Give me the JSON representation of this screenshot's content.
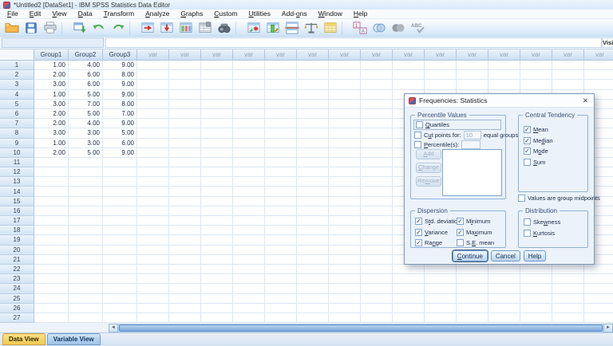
{
  "window": {
    "title": "*Untitled2 [DataSet1] - IBM SPSS Statistics Data Editor"
  },
  "menu": {
    "items": [
      {
        "label": "File",
        "mn": 0
      },
      {
        "label": "Edit",
        "mn": 0
      },
      {
        "label": "View",
        "mn": 0
      },
      {
        "label": "Data",
        "mn": 0
      },
      {
        "label": "Transform",
        "mn": 0
      },
      {
        "label": "Analyze",
        "mn": 0
      },
      {
        "label": "Graphs",
        "mn": 0
      },
      {
        "label": "Custom",
        "mn": 0
      },
      {
        "label": "Utilities",
        "mn": 0
      },
      {
        "label": "Add-ons",
        "mn": 4
      },
      {
        "label": "Window",
        "mn": 0
      },
      {
        "label": "Help",
        "mn": 0
      }
    ]
  },
  "toolbar": {
    "icons": [
      "open-data",
      "save",
      "print",
      "recall-dialogs",
      "undo",
      "redo",
      "goto-case",
      "goto-variable",
      "variables",
      "variable-properties",
      "find",
      "insert-cases",
      "insert-variable",
      "split-file",
      "weight-cases",
      "select-cases",
      "value-labels",
      "variable-sets",
      "show-all-variables",
      "spell-check"
    ]
  },
  "cellbar": {
    "visible_indicator": "Visi"
  },
  "grid": {
    "columns": [
      "Group1",
      "Group2",
      "Group3"
    ],
    "var_label": "var",
    "var_count": 15,
    "total_rows": 28,
    "rows": [
      [
        "1.00",
        "4.00",
        "9.00"
      ],
      [
        "2.00",
        "6.00",
        "8.00"
      ],
      [
        "3.00",
        "6.00",
        "9.00"
      ],
      [
        "1.00",
        "5.00",
        "9.00"
      ],
      [
        "3.00",
        "7.00",
        "8.00"
      ],
      [
        "2.00",
        "5.00",
        "7.00"
      ],
      [
        "2.00",
        "4.00",
        "9.00"
      ],
      [
        "3.00",
        "3.00",
        "5.00"
      ],
      [
        "1.00",
        "3.00",
        "6.00"
      ],
      [
        "2.00",
        "5.00",
        "9.00"
      ]
    ]
  },
  "tabs": {
    "data_view": "Data View",
    "variable_view": "Variable View"
  },
  "scrollbar": {
    "left_glyph": "◄",
    "right_glyph": "►"
  },
  "dialog": {
    "title": "Frequencies: Statistics",
    "close_glyph": "✕",
    "percentile_values": {
      "title": "Percentile Values",
      "quartiles": {
        "label": "Quartiles",
        "mn": 0,
        "checked": false
      },
      "cut_points": {
        "label": "Cut points for:",
        "mn": 1,
        "checked": false,
        "value": "10",
        "suffix": "equal groups"
      },
      "percentiles": {
        "label": "Percentile(s):",
        "mn": 0,
        "checked": false,
        "value": ""
      },
      "list_buttons": [
        {
          "label": "Add",
          "mn": 0,
          "enabled": false
        },
        {
          "label": "Change",
          "mn": 0,
          "enabled": false
        },
        {
          "label": "Remove",
          "mn": 2,
          "enabled": false
        }
      ]
    },
    "central_tendency": {
      "title": "Central Tendency",
      "items": [
        {
          "label": "Mean",
          "mn": 0,
          "checked": true
        },
        {
          "label": "Median",
          "mn": 2,
          "checked": true
        },
        {
          "label": "Mode",
          "mn": 1,
          "checked": true
        },
        {
          "label": "Sum",
          "mn": 0,
          "checked": false
        }
      ]
    },
    "values_are_group_midpoints": {
      "label": "Values are group midpoints",
      "mn": -1,
      "checked": false
    },
    "dispersion": {
      "title": "Dispersion",
      "col1": [
        {
          "label": "Std. deviation",
          "mn": 1,
          "checked": true
        },
        {
          "label": "Variance",
          "mn": 0,
          "checked": true
        },
        {
          "label": "Range",
          "mn": 2,
          "checked": true
        }
      ],
      "col2": [
        {
          "label": "Minimum",
          "mn": 1,
          "checked": true
        },
        {
          "label": "Maximum",
          "mn": 2,
          "checked": true
        },
        {
          "label": "S.E. mean",
          "mn": 2,
          "checked": false
        }
      ]
    },
    "distribution": {
      "title": "Distribution",
      "items": [
        {
          "label": "Skewness",
          "mn": 3,
          "checked": false
        },
        {
          "label": "Kurtosis",
          "mn": 0,
          "checked": false
        }
      ]
    },
    "actions": [
      {
        "label": "Continue",
        "mn": 0,
        "default": true
      },
      {
        "label": "Cancel",
        "mn": -1,
        "default": false
      },
      {
        "label": "Help",
        "mn": -1,
        "default": false
      }
    ]
  },
  "colors": {
    "titlebar_bg": "#ECF5FD",
    "toolbar_bg": "#CFE4F7",
    "grid_header_bg": "#CDDFF2",
    "active_tab": "#F3C94E",
    "inactive_tab": "#9DC2E8",
    "dialog_bg": "#ECF2FA",
    "accent_border": "#6F9CC9"
  }
}
